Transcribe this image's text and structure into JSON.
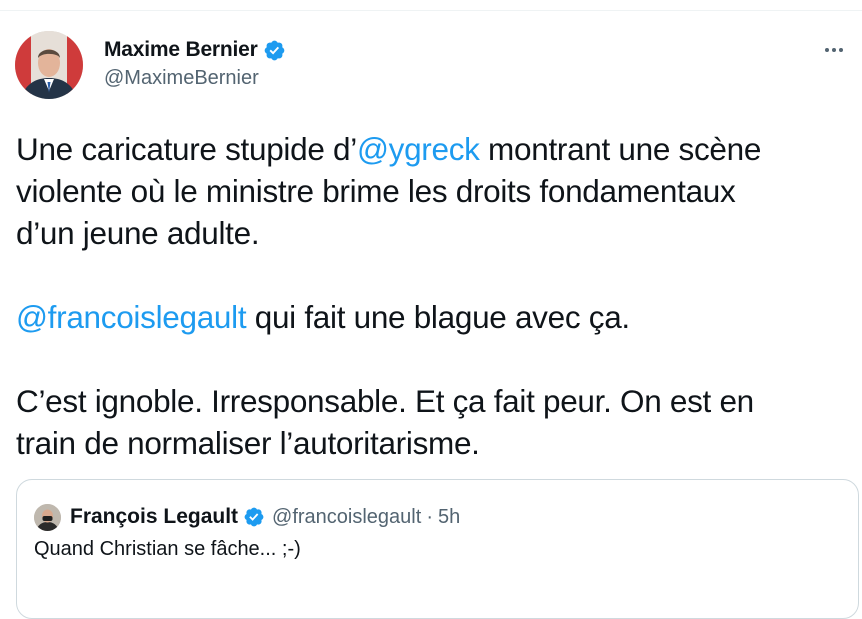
{
  "author": {
    "display_name": "Maxime Bernier",
    "handle": "@MaximeBernier"
  },
  "tweet": {
    "p1_before": "Une caricature stupide d’",
    "p1_mention": "@ygreck",
    "p1_after": " montrant une scène",
    "p1_line2": "violente où le ministre brime les droits fondamentaux",
    "p1_line3": "d’un jeune adulte.",
    "p2_mention": "@francoislegault",
    "p2_after": " qui fait une blague avec ça.",
    "p3_line1": "C’est ignoble. Irresponsable. Et ça fait peur. On est en",
    "p3_line2": "train de normaliser l’autoritarisme."
  },
  "quoted_tweet": {
    "display_name": "François Legault",
    "handle": "@francoislegault",
    "separator": "·",
    "time": "5h",
    "text": "Quand Christian se fâche... ;-)"
  },
  "icons": {
    "verified": "verified-badge-icon",
    "more": "more-options-icon"
  },
  "colors": {
    "link": "#1d9bf0",
    "text": "#0f1419",
    "secondary": "#536471",
    "border": "#cfd9de"
  }
}
